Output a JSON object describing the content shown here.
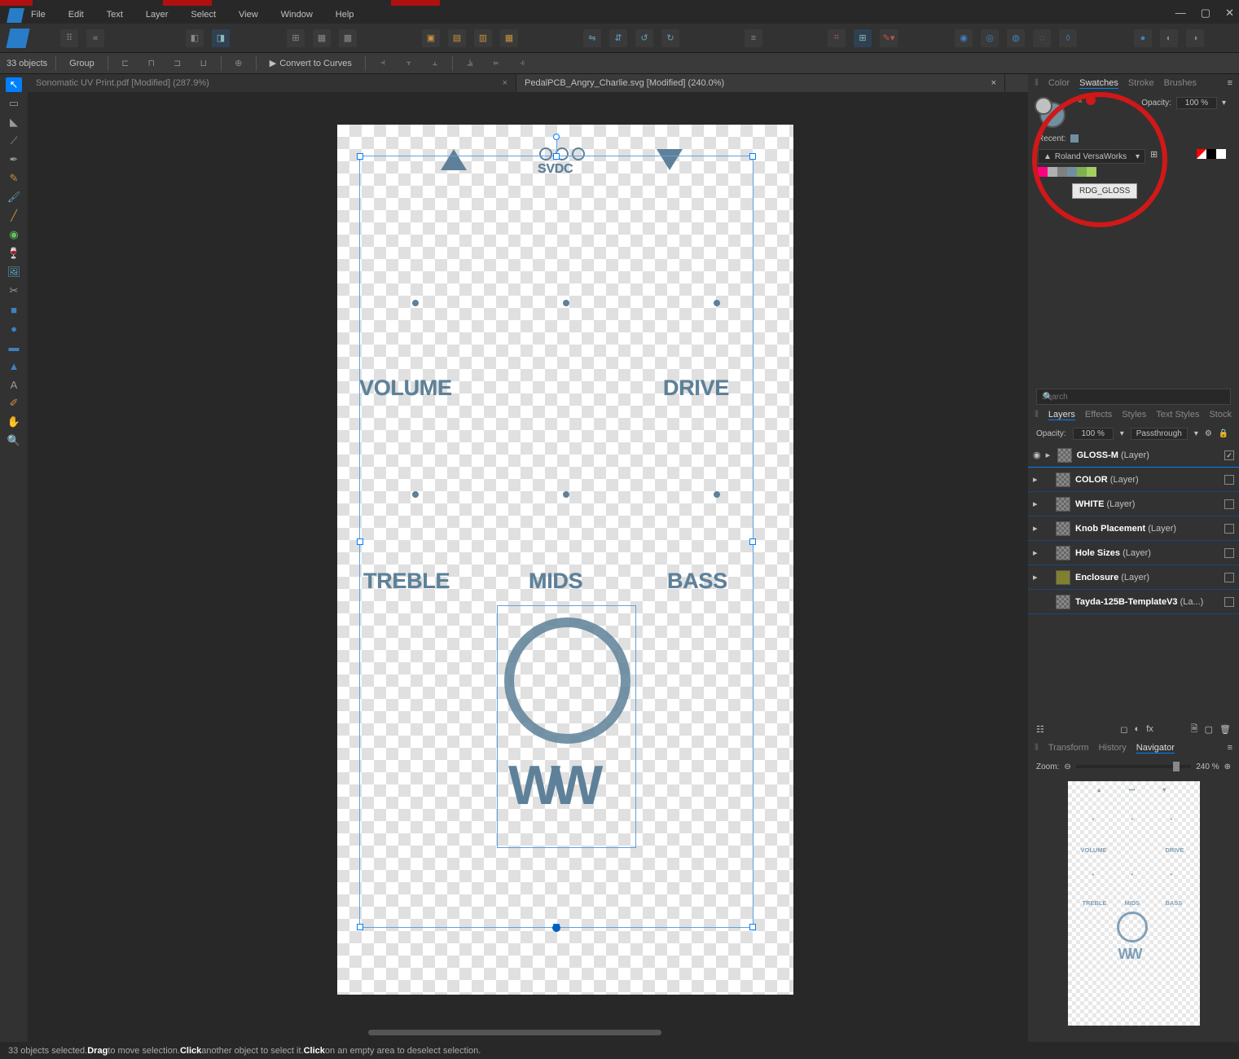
{
  "menu": [
    "File",
    "Edit",
    "Text",
    "Layer",
    "Select",
    "View",
    "Window",
    "Help"
  ],
  "ctx": {
    "sel_count": "33 objects",
    "group": "Group",
    "convert": "Convert to Curves"
  },
  "doc_tabs": [
    {
      "label": "Sonomatic UV Print.pdf [Modified] (287.9%)",
      "active": false
    },
    {
      "label": "PedalPCB_Angry_Charlie.svg [Modified] (240.0%)",
      "active": true
    }
  ],
  "panels": {
    "color_tabs": [
      "Color",
      "Swatches",
      "Stroke",
      "Brushes"
    ],
    "color_active": "Swatches",
    "opacity_label": "Opacity:",
    "opacity_value": "100 %",
    "recent_label": "Recent:",
    "palette_name": "Roland VersaWorks",
    "palette_colors": [
      "#ff0080",
      "#b0b0b0",
      "#808080",
      "#7090a0",
      "#80c040",
      "#80c040"
    ],
    "tri_colors": [
      "#ffffff",
      "#000000",
      "#ffffff"
    ],
    "tooltip": "RDG_GLOSS",
    "search_ph": "Search",
    "layer_tabs": [
      "Layers",
      "Effects",
      "Styles",
      "Text Styles",
      "Stock"
    ],
    "layer_active": "Layers",
    "lopacity_label": "Opacity:",
    "lopacity_value": "100 %",
    "blend_value": "Passthrough",
    "layers": [
      {
        "name": "GLOSS-M",
        "suffix": "(Layer)",
        "checked": true,
        "thumb": "checker"
      },
      {
        "name": "COLOR",
        "suffix": "(Layer)",
        "checked": false,
        "thumb": "checker"
      },
      {
        "name": "WHITE",
        "suffix": "(Layer)",
        "checked": false,
        "thumb": "checker"
      },
      {
        "name": "Knob Placement",
        "suffix": "(Layer)",
        "checked": false,
        "thumb": "checker"
      },
      {
        "name": "Hole Sizes",
        "suffix": "(Layer)",
        "checked": false,
        "thumb": "checker"
      },
      {
        "name": "Enclosure",
        "suffix": "(Layer)",
        "checked": false,
        "thumb": "olive"
      },
      {
        "name": "Tayda-125B-TemplateV3",
        "suffix": "(La...)",
        "checked": false,
        "thumb": "checker"
      }
    ],
    "nav_tabs": [
      "Transform",
      "History",
      "Navigator"
    ],
    "nav_active": "Navigator",
    "zoom_label": "Zoom:",
    "zoom_value": "240 %"
  },
  "canvas_text": {
    "svdc": "SVDC",
    "volume": "VOLUME",
    "drive": "DRIVE",
    "treble": "TREBLE",
    "mids": "MIDS",
    "bass": "BASS"
  },
  "status": {
    "pre": "33 objects selected. ",
    "b1": "Drag",
    "t1": " to move selection. ",
    "b2": "Click",
    "t2": " another object to select it. ",
    "b3": "Click",
    "t3": " on an empty area to deselect selection."
  }
}
